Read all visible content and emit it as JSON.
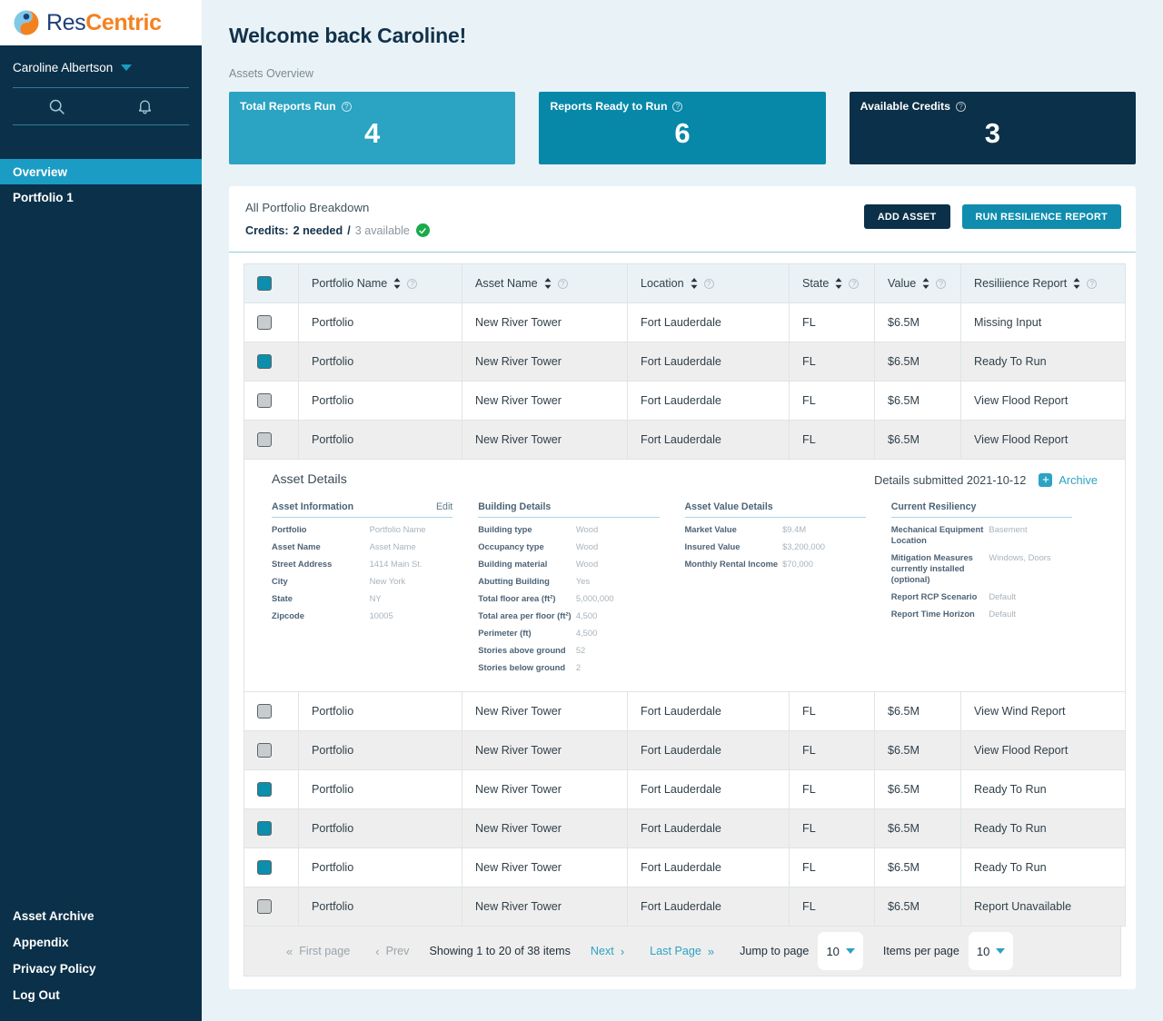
{
  "brand": {
    "name_part1": "Res",
    "name_part2": "Centric",
    "logo_icon": "rescentric-circle-logo"
  },
  "sidebar": {
    "user": {
      "name": "Caroline Albertson",
      "caret_icon": "chevron-down-icon"
    },
    "tools": {
      "search_icon": "search-icon",
      "bell_icon": "notification-bell-icon"
    },
    "nav": [
      {
        "label": "Overview",
        "active": true
      },
      {
        "label": "Portfolio 1",
        "active": false
      }
    ],
    "footer_links": [
      {
        "label": "Asset Archive"
      },
      {
        "label": "Appendix"
      },
      {
        "label": "Privacy Policy"
      },
      {
        "label": "Log Out"
      }
    ]
  },
  "header": {
    "welcome": "Welcome back Caroline!",
    "subtitle": "Assets Overview"
  },
  "cards": [
    {
      "label": "Total Reports Run",
      "value": "4",
      "color": "#2ba3c2",
      "info_icon": "help-icon"
    },
    {
      "label": "Reports Ready to Run",
      "value": "6",
      "color": "#0788a9",
      "info_icon": "help-icon"
    },
    {
      "label": "Available Credits",
      "value": "3",
      "color": "#0b3049",
      "info_icon": "help-icon"
    }
  ],
  "panel": {
    "title": "All Portfolio Breakdown",
    "credits_label": "Credits:",
    "credits_needed": "2 needed",
    "credits_sep": "/",
    "credits_available": "3 available",
    "credits_status_icon": "check-circle-icon",
    "buttons": {
      "add_asset": "ADD ASSET",
      "run_report": "RUN RESILIENCE REPORT"
    }
  },
  "table": {
    "select_all_checked": true,
    "columns": [
      {
        "label": "Portfolio Name",
        "sort_icon": "sort-icon",
        "info_icon": "help-icon"
      },
      {
        "label": "Asset Name",
        "sort_icon": "sort-icon",
        "info_icon": "help-icon"
      },
      {
        "label": "Location",
        "sort_icon": "sort-icon",
        "info_icon": "help-icon"
      },
      {
        "label": "State",
        "sort_icon": "sort-icon",
        "info_icon": "help-icon"
      },
      {
        "label": "Value",
        "sort_icon": "sort-icon",
        "info_icon": "help-icon"
      },
      {
        "label": "Resiliience Report",
        "sort_icon": "sort-icon",
        "info_icon": "help-icon"
      }
    ],
    "rows_top": [
      {
        "checked": false,
        "portfolio": "Portfolio",
        "asset": "New River Tower",
        "location": "Fort Lauderdale",
        "state": "FL",
        "value": "$6.5M",
        "report": "Missing Input",
        "report_style": "missing"
      },
      {
        "checked": true,
        "portfolio": "Portfolio",
        "asset": "New River Tower",
        "location": "Fort Lauderdale",
        "state": "FL",
        "value": "$6.5M",
        "report": "Ready To Run",
        "report_style": "ready"
      },
      {
        "checked": false,
        "portfolio": "Portfolio",
        "asset": "New River Tower",
        "location": "Fort Lauderdale",
        "state": "FL",
        "value": "$6.5M",
        "report": "View Flood Report",
        "report_style": "view"
      },
      {
        "checked": false,
        "portfolio": "Portfolio",
        "asset": "New River Tower",
        "location": "Fort Lauderdale",
        "state": "FL",
        "value": "$6.5M",
        "report": "View Flood Report",
        "report_style": "view"
      }
    ],
    "rows_bottom": [
      {
        "checked": false,
        "portfolio": "Portfolio",
        "asset": "New River Tower",
        "location": "Fort Lauderdale",
        "state": "FL",
        "value": "$6.5M",
        "report": "View Wind Report",
        "report_style": "view"
      },
      {
        "checked": false,
        "portfolio": "Portfolio",
        "asset": "New River Tower",
        "location": "Fort Lauderdale",
        "state": "FL",
        "value": "$6.5M",
        "report": "View Flood Report",
        "report_style": "view"
      },
      {
        "checked": true,
        "portfolio": "Portfolio",
        "asset": "New River Tower",
        "location": "Fort Lauderdale",
        "state": "FL",
        "value": "$6.5M",
        "report": "Ready To Run",
        "report_style": "ready"
      },
      {
        "checked": true,
        "portfolio": "Portfolio",
        "asset": "New River Tower",
        "location": "Fort Lauderdale",
        "state": "FL",
        "value": "$6.5M",
        "report": "Ready To Run",
        "report_style": "ready"
      },
      {
        "checked": true,
        "portfolio": "Portfolio",
        "asset": "New River Tower",
        "location": "Fort Lauderdale",
        "state": "FL",
        "value": "$6.5M",
        "report": "Ready To Run",
        "report_style": "ready"
      },
      {
        "checked": false,
        "portfolio": "Portfolio",
        "asset": "New River Tower",
        "location": "Fort Lauderdale",
        "state": "FL",
        "value": "$6.5M",
        "report": "Report Unavailable",
        "report_style": "unavail"
      }
    ]
  },
  "details": {
    "title": "Asset Details",
    "submitted": "Details submitted 2021-10-12",
    "archive_label": "Archive",
    "archive_icon": "archive-box-icon",
    "columns": [
      {
        "title": "Asset Information",
        "edit": "Edit",
        "rows": [
          {
            "k": "Portfolio",
            "v": "Portfolio Name"
          },
          {
            "k": "Asset Name",
            "v": "Asset Name"
          },
          {
            "k": "Street Address",
            "v": "1414 Main St."
          },
          {
            "k": "City",
            "v": "New York"
          },
          {
            "k": "State",
            "v": "NY"
          },
          {
            "k": "Zipcode",
            "v": "10005"
          }
        ]
      },
      {
        "title": "Building Details",
        "edit": "",
        "rows": [
          {
            "k": "Building type",
            "v": "Wood"
          },
          {
            "k": "Occupancy type",
            "v": "Wood"
          },
          {
            "k": "Building material",
            "v": "Wood"
          },
          {
            "k": "Abutting Building",
            "v": "Yes"
          },
          {
            "k": "Total floor area (ft²)",
            "v": "5,000,000"
          },
          {
            "k": "Total area per floor (ft²)",
            "v": "4,500"
          },
          {
            "k": "Perimeter (ft)",
            "v": "4,500"
          },
          {
            "k": "Stories above ground",
            "v": "52"
          },
          {
            "k": "Stories below ground",
            "v": "2"
          }
        ]
      },
      {
        "title": "Asset Value Details",
        "edit": "",
        "rows": [
          {
            "k": "Market Value",
            "v": "$9.4M"
          },
          {
            "k": "Insured Value",
            "v": "$3,200,000"
          },
          {
            "k": "Monthly Rental Income",
            "v": "$70,000"
          }
        ]
      },
      {
        "title": "Current Resiliency",
        "edit": "",
        "rows": [
          {
            "k": "Mechanical Equipment Location",
            "v": "Basement"
          },
          {
            "k": "Mitigation Measures currently installed (optional)",
            "v": "Windows, Doors"
          },
          {
            "k": "Report RCP Scenario",
            "v": "Default"
          },
          {
            "k": "Report Time Horizon",
            "v": "Default"
          }
        ]
      }
    ]
  },
  "pagination": {
    "first_page": "First page",
    "prev": "Prev",
    "showing": "Showing 1 to 20 of 38 items",
    "next": "Next",
    "last_page": "Last Page",
    "jump_label": "Jump to page",
    "jump_value": "10",
    "per_page_label": "Items per page",
    "per_page_value": "10",
    "first_icon": "double-chevron-left-icon",
    "prev_icon": "chevron-left-icon",
    "next_icon": "chevron-right-icon",
    "last_icon": "double-chevron-right-icon"
  }
}
